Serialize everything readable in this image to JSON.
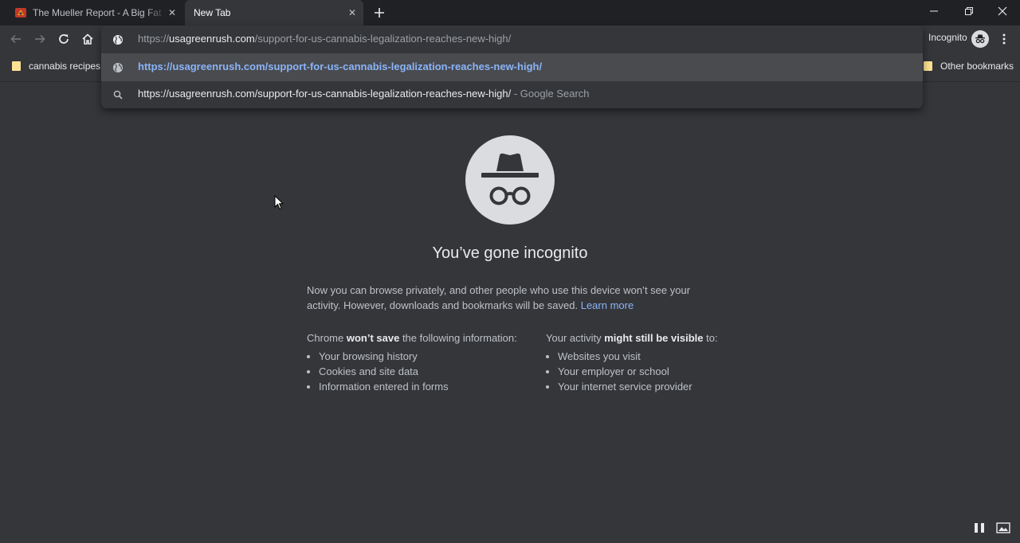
{
  "tabs": [
    {
      "title": "The Mueller Report - A Big Fat Nothing",
      "active": false
    },
    {
      "title": "New Tab",
      "active": true
    }
  ],
  "toolbar": {
    "incognito_label": "Incognito"
  },
  "omnibox": {
    "input_prefix": "https://",
    "input_host": "usagreenrush.com",
    "input_path": "/support-for-us-cannabis-legalization-reaches-new-high/",
    "suggestion_url": "https://usagreenrush.com/support-for-us-cannabis-legalization-reaches-new-high/",
    "search_query": "https://usagreenrush.com/support-for-us-cannabis-legalization-reaches-new-high/",
    "search_suffix": " - Google Search"
  },
  "bookmarks": {
    "items": [
      "cannabis recipes"
    ],
    "other": "Other bookmarks"
  },
  "incognito_page": {
    "heading": "You’ve gone incognito",
    "para_line1": "Now you can browse privately, and other people who use this device won’t see your",
    "para_line2": "activity. However, downloads and bookmarks will be saved.",
    "learn_more": "Learn more",
    "left": {
      "pre": "Chrome ",
      "bold": "won’t save",
      "post": " the following information:",
      "items": [
        "Your browsing history",
        "Cookies and site data",
        "Information entered in forms"
      ]
    },
    "right": {
      "pre": "Your activity ",
      "bold": "might still be visible",
      "post": " to:",
      "items": [
        "Websites you visit",
        "Your employer or school",
        "Your internet service provider"
      ]
    }
  },
  "colors": {
    "frame": "#202124",
    "toolbar": "#35363a",
    "link": "#8ab4f8",
    "folder": "#fde293"
  }
}
